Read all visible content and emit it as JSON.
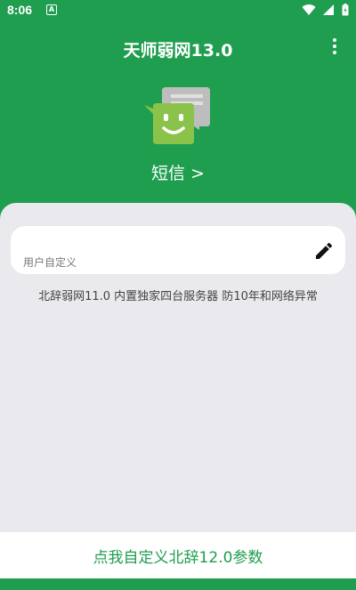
{
  "status_bar": {
    "time": "8:06",
    "notification_glyph": "A",
    "icons": [
      "wifi-icon",
      "signal-icon",
      "battery-icon"
    ]
  },
  "app_bar": {
    "title": "天师弱网13.0",
    "menu_icon": "more-vert-icon"
  },
  "hero": {
    "app_icon": "sms-app-icon",
    "app_name_link": "短信 >"
  },
  "input": {
    "value": "",
    "label": "用户自定义",
    "edit_icon": "pencil-icon"
  },
  "info_text": "北辞弱网11.0 内置独家四台服务器 防10年和网络异常",
  "bottom_action": "点我自定义北辞12.0参数",
  "colors": {
    "primary": "#1f9e4f",
    "panel": "#e9e9ee",
    "card": "#ffffff",
    "icon_green": "#8bc34a"
  }
}
